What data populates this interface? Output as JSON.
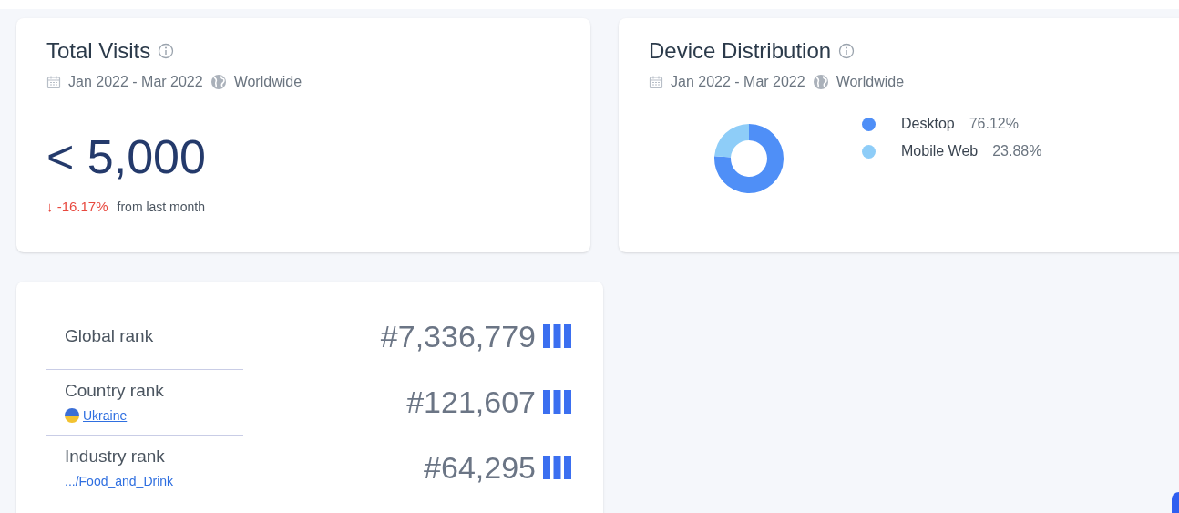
{
  "total_visits": {
    "title": "Total Visits",
    "date_range": "Jan 2022 - Mar 2022",
    "region": "Worldwide",
    "value": "< 5,000",
    "change": "↓ -16.17%",
    "change_note": "from last month"
  },
  "device_distribution": {
    "title": "Device Distribution",
    "date_range": "Jan 2022 - Mar 2022",
    "region": "Worldwide",
    "chart_data": {
      "type": "donut",
      "categories": [
        "Desktop",
        "Mobile Web"
      ],
      "values": [
        76.12,
        23.88
      ]
    },
    "legend": [
      {
        "value": "76.12%",
        "color": "#4f8ff7"
      },
      {
        "value": "23.88%",
        "color": "#8ecdf8"
      }
    ]
  },
  "ranks": [
    {
      "label": "Global rank",
      "value": "#7,336,779"
    },
    {
      "label": "Country rank",
      "link": "Ukraine",
      "value": "#121,607"
    },
    {
      "label": "Industry rank",
      "link": ".../Food_and_Drink",
      "value": "#64,295"
    }
  ]
}
